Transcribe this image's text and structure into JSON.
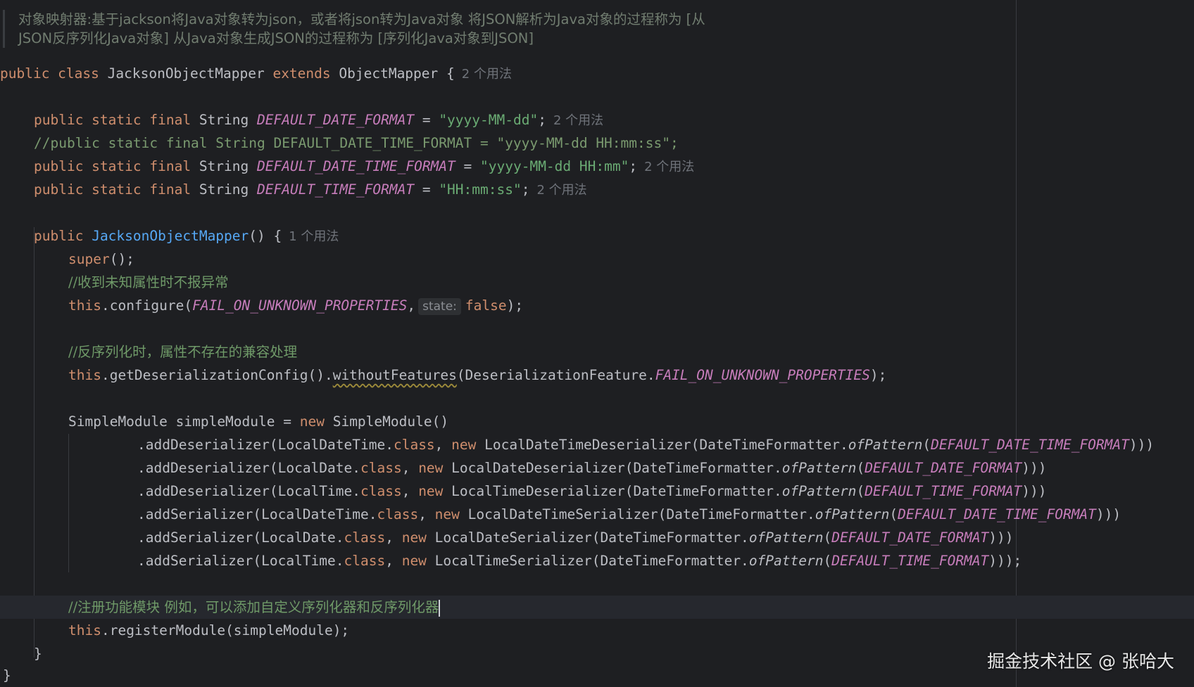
{
  "doc_comment": {
    "line1": "对象映射器:基于jackson将Java对象转为json，或者将json转为Java对象 将JSON解析为Java对象的过程称为 [从",
    "line2": "JSON反序列化Java对象] 从Java对象生成JSON的过程称为 [序列化Java对象到JSON]"
  },
  "code": {
    "class_kw": "public class",
    "class_name": "JacksonObjectMapper",
    "extends_kw": "extends",
    "parent": "ObjectMapper {",
    "class_usages": "2 个用法",
    "modifiers": "public static final",
    "string_type": "String",
    "eq": " = ",
    "date_format_name": "DEFAULT_DATE_FORMAT",
    "date_format_value": "\"yyyy-MM-dd\"",
    "date_format_usages": "2 个用法",
    "commented_line": "//public static final String DEFAULT_DATE_TIME_FORMAT = \"yyyy-MM-dd HH:mm:ss\";",
    "date_time_format_name": "DEFAULT_DATE_TIME_FORMAT",
    "date_time_format_value": "\"yyyy-MM-dd HH:mm\"",
    "date_time_format_usages": "2 个用法",
    "time_format_name": "DEFAULT_TIME_FORMAT",
    "time_format_value": "\"HH:mm:ss\"",
    "time_format_usages": "2 个用法",
    "public_kw": "public",
    "ctor_name": "JacksonObjectMapper",
    "ctor_rest": "() {",
    "ctor_usages": "1 个用法",
    "super_kw": "super",
    "super_rest": "();",
    "comment_unknown": "//收到未知属性时不报异常",
    "this_kw": "this",
    "configure_call": ".configure(",
    "fail_unknown": "FAIL_ON_UNKNOWN_PROPERTIES",
    "comma": ",",
    "state_hint": "state:",
    "false_kw": "false",
    "close_semi": ");",
    "comment_compat": "//反序列化时，属性不存在的兼容处理",
    "get_config": ".getDeserializationConfig().",
    "without_features": "withoutFeatures",
    "deser_feature": "(DeserializationFeature.",
    "simple_module_decl": "SimpleModule simpleModule = ",
    "new_kw": "new",
    "simple_module_ctor": " SimpleModule()",
    "add_deser": ".addDeserializer(",
    "add_ser": ".addSerializer(",
    "class_kw_lc": "class",
    "local_date_time": "LocalDateTime.",
    "local_date": "LocalDate.",
    "local_time": "LocalTime.",
    "ldt_deser": " LocalDateTimeDeserializer(DateTimeFormatter.",
    "ld_deser": " LocalDateDeserializer(DateTimeFormatter.",
    "lt_deser": " LocalTimeDeserializer(DateTimeFormatter.",
    "ldt_ser": " LocalDateTimeSerializer(DateTimeFormatter.",
    "ld_ser": " LocalDateSerializer(DateTimeFormatter.",
    "lt_ser": " LocalTimeSerializer(DateTimeFormatter.",
    "of_pattern": "ofPattern",
    "close3": ")))",
    "close3_semi": ")));",
    "comment_register": "//注册功能模块 例如，可以添加自定义序列化器和反序列化器",
    "register_call": ".registerModule(simpleModule);",
    "close_brace": "}"
  },
  "watermark": "掘金技术社区 @ 张哈大",
  "colors": {
    "background": "#1e1f22",
    "keyword": "#cf8e6d",
    "constant": "#c77dbb",
    "function": "#56a8f5",
    "string": "#6aab73",
    "comment": "#7a9a6f",
    "text": "#bcbec4"
  }
}
